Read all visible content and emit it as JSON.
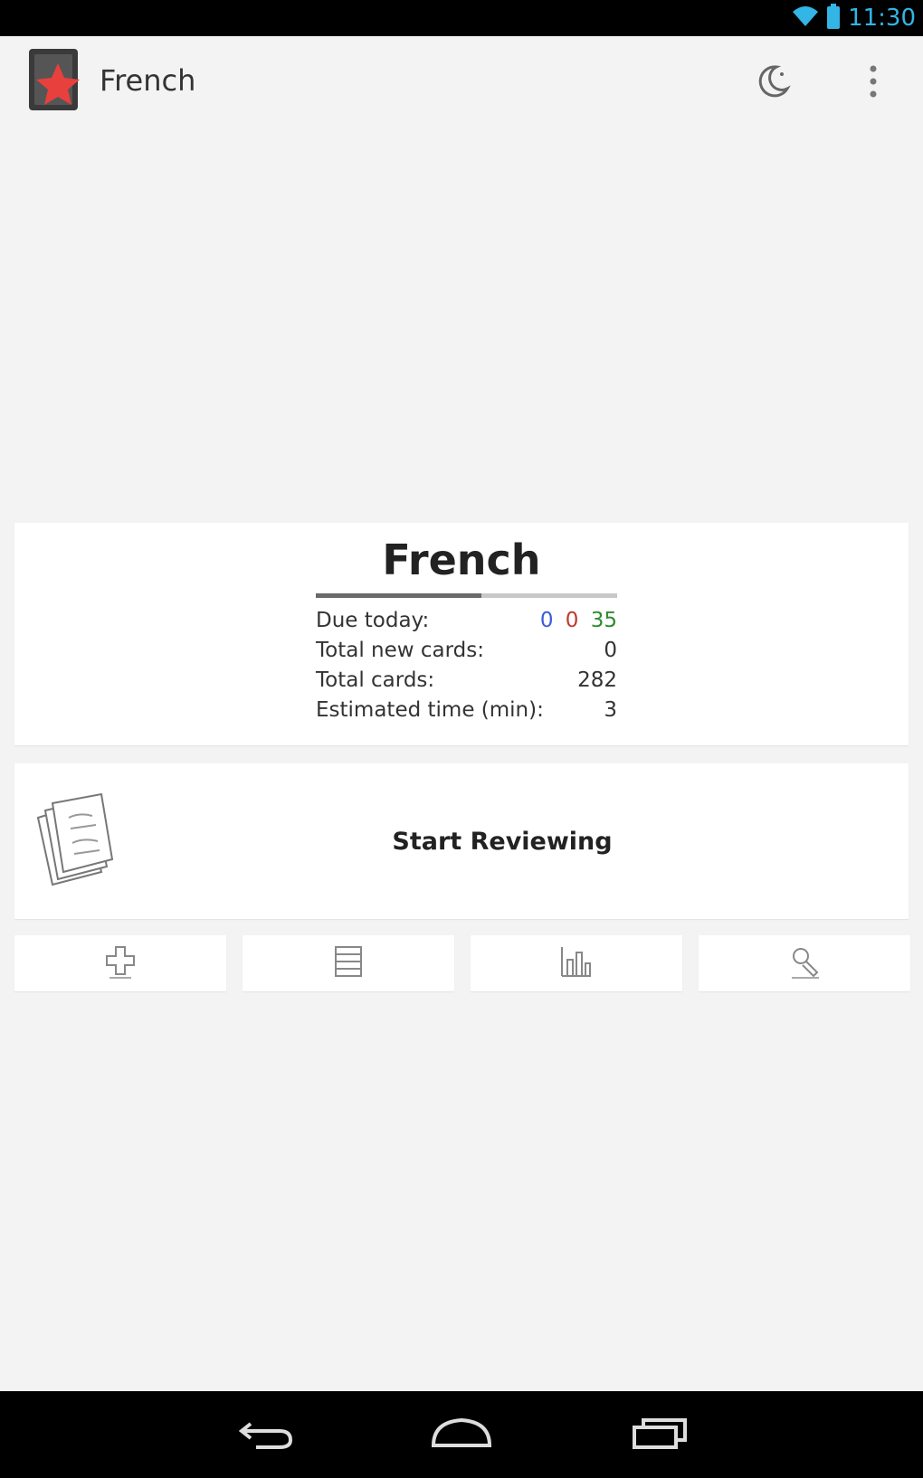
{
  "status_bar": {
    "time": "11:30",
    "wifi_icon": "wifi-icon",
    "battery_icon": "battery-icon",
    "accent_color": "#33b5e5"
  },
  "action_bar": {
    "title": "French",
    "app_icon": "anki-star-icon",
    "night_mode_icon": "moon-icon",
    "overflow_icon": "overflow-menu-icon"
  },
  "deck": {
    "name": "French",
    "progress_fraction": 0.55,
    "stats": {
      "due_today_label": "Due today:",
      "due_new": "0",
      "due_learning": "0",
      "due_review": "35",
      "total_new_label": "Total new cards:",
      "total_new_value": "0",
      "total_cards_label": "Total cards:",
      "total_cards_value": "282",
      "estimated_time_label": "Estimated time (min):",
      "estimated_time_value": "3"
    },
    "colors": {
      "new": "#3b5bdb",
      "learning": "#c0392b",
      "review": "#2e8b2e"
    }
  },
  "review": {
    "label": "Start Reviewing",
    "illustration": "flashcards-illustration"
  },
  "tools": [
    {
      "icon": "add-card-icon"
    },
    {
      "icon": "card-browser-icon"
    },
    {
      "icon": "statistics-icon"
    },
    {
      "icon": "deck-options-icon"
    }
  ],
  "nav_bar": {
    "back_icon": "back-icon",
    "home_icon": "home-icon",
    "recents_icon": "recent-apps-icon"
  }
}
